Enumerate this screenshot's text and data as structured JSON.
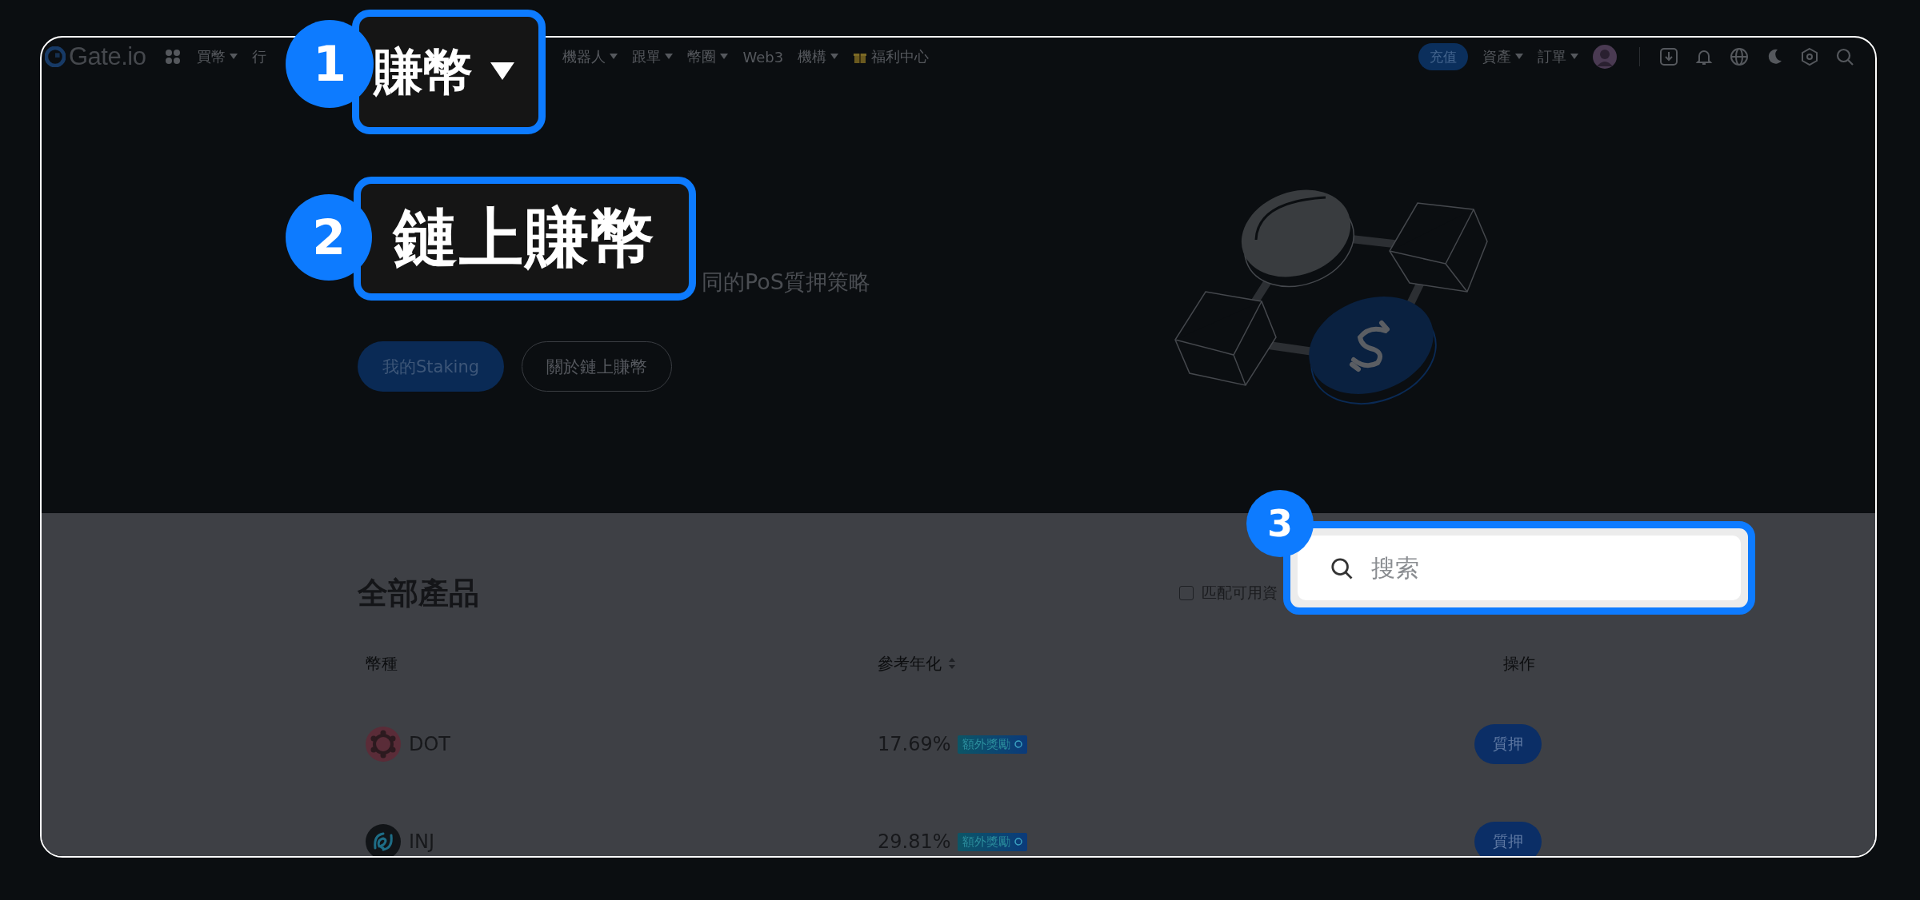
{
  "nav": {
    "logo": "Gate.io",
    "items": [
      {
        "label": "買幣",
        "dropdown": true,
        "kind": "text"
      },
      {
        "label": "行",
        "dropdown": false,
        "kind": "text"
      },
      {
        "label": "機器人",
        "dropdown": true,
        "kind": "text"
      },
      {
        "label": "跟單",
        "dropdown": true,
        "kind": "text"
      },
      {
        "label": "幣圈",
        "dropdown": true,
        "kind": "text"
      },
      {
        "label": "Web3",
        "dropdown": false,
        "kind": "text"
      },
      {
        "label": "機構",
        "dropdown": true,
        "kind": "text"
      },
      {
        "label": "福利中心",
        "dropdown": false,
        "kind": "gift"
      }
    ],
    "deposit_button": "充值",
    "right_items": [
      {
        "label": "資產",
        "dropdown": true
      },
      {
        "label": "訂單",
        "dropdown": true
      }
    ]
  },
  "hero": {
    "subtitle": "同的PoS質押策略",
    "buttons": [
      {
        "label": "我的Staking",
        "kind": "primary"
      },
      {
        "label": "關於鏈上賺幣",
        "kind": "outline"
      }
    ]
  },
  "products": {
    "title": "全部產品",
    "filter": {
      "label": "匹配可用資",
      "checked": false
    },
    "columns": [
      {
        "label": "幣種",
        "sortable": false
      },
      {
        "label": "參考年化",
        "sortable": true
      },
      {
        "label": "操作",
        "sortable": false
      }
    ],
    "rows": [
      {
        "coin": "DOT",
        "kind": "dot",
        "apr": "17.69%",
        "badge": "額外獎勵",
        "action": "質押"
      },
      {
        "coin": "INJ",
        "kind": "inj",
        "apr": "29.81%",
        "badge": "額外獎勵",
        "action": "質押"
      }
    ]
  },
  "callouts": [
    {
      "number": "1",
      "text": "賺幣",
      "dropdown": true
    },
    {
      "number": "2",
      "text": "鏈上賺幣",
      "dropdown": false
    },
    {
      "number": "3",
      "placeholder": "搜索"
    }
  ]
}
